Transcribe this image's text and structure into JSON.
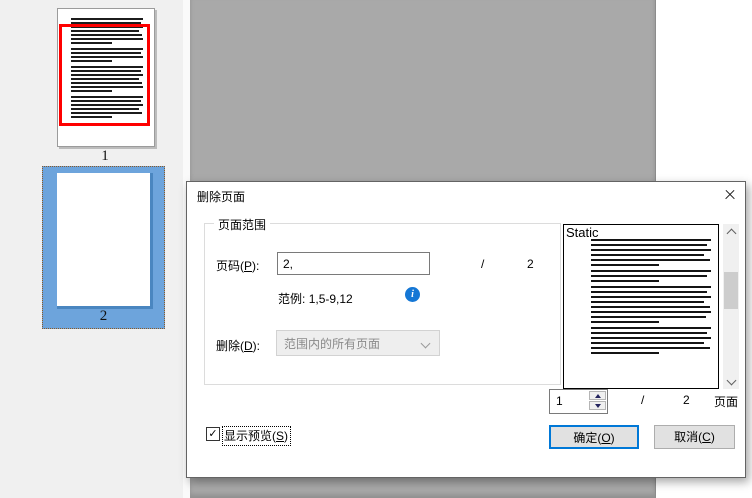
{
  "thumbnails": {
    "page1": {
      "label": "1",
      "paragraph_lines": [
        7,
        4,
        7,
        6
      ]
    },
    "page2": {
      "label": "2"
    }
  },
  "dialog": {
    "title": "删除页面",
    "group_title": "页面范围",
    "page_row": {
      "label_pre": "页码(",
      "accel": "P",
      "label_post": "):",
      "input_value": "2,",
      "separator": "/",
      "total": "2"
    },
    "example": {
      "label": "范例:",
      "value": "1,5-9,12",
      "info_icon": "i"
    },
    "delete_row": {
      "label_pre": "删除(",
      "accel": "D",
      "label_post": "):",
      "option": "范围内的所有页面"
    },
    "preview": {
      "overlay_text": "Static",
      "paragraph_lines": [
        6,
        3,
        8,
        6
      ],
      "spin_value": "1",
      "separator": "/",
      "total": "2",
      "unit_label": "页面"
    },
    "checkbox": {
      "label_pre": "显示预览(",
      "accel": "S",
      "label_post": ")",
      "checked": "✓"
    },
    "ok": {
      "label_pre": "确定(",
      "accel": "O",
      "label_post": ")"
    },
    "cancel": {
      "label_pre": "取消(",
      "accel": "C",
      "label_post": ")"
    }
  },
  "colors": {
    "accent": "#0078d7",
    "selection_blue": "#6da4dc",
    "highlight_red": "#fe0000",
    "info_blue": "#1577d5",
    "doc_background": "#a9a9a9",
    "panel_background": "#f0f0f0"
  }
}
